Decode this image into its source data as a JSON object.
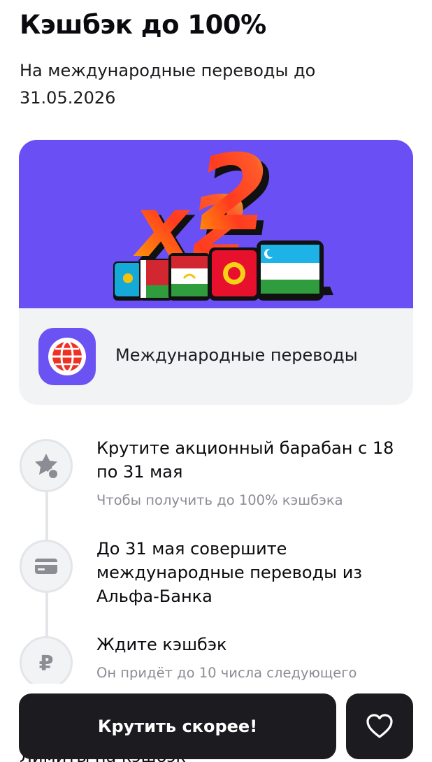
{
  "header": {
    "title": "Кэшбэк до 100%",
    "subtitle": "На международные переводы до 31.05.2026"
  },
  "banner": {
    "badge_text": "x2",
    "background_color": "#6a4ff5",
    "flags": [
      "kazakhstan-flag",
      "belarus-flag",
      "tajikistan-flag",
      "kyrgyzstan-flag",
      "uzbekistan-flag"
    ]
  },
  "product": {
    "icon": "globe-icon",
    "label": "Международные переводы"
  },
  "steps": [
    {
      "icon": "star-hand-icon",
      "title": "Крутите акционный барабан с 18 по 31 мая",
      "subtitle": "Чтобы получить до 100% кэшбэка"
    },
    {
      "icon": "card-icon",
      "title": "До 31 мая совершите международные переводы из Альфа-Банка",
      "subtitle": ""
    },
    {
      "icon": "ruble-icon",
      "title": "Ждите кэшбэк",
      "subtitle": "Он придёт до 10 числа следующего"
    }
  ],
  "footer": {
    "cta_label": "Крутить скорее!",
    "favorite_icon": "heart-icon",
    "obscured_text": "Лимиты на кэшбэк"
  },
  "colors": {
    "accent": "#6a4ff5",
    "button": "#1c1c20",
    "muted": "#8b8c94"
  }
}
